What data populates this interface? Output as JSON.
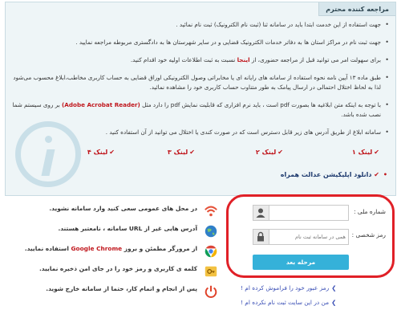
{
  "notice": {
    "title": "مراجعه کننده محترم",
    "bullets": [
      "جهت استفاده از این خدمت ابتدا باید در سامانه ثنا (ثبت نام الکترونیک) ثبت نام نمائید .",
      "جهت ثبت نام در مراکز استان ها به دفاتر خدمات الکترونیک قضایی و در سایر شهرستان ها به دادگستری مربوطه مراجعه نمایید .",
      "طبق ماده ۱۳ آیین نامه نحوه استفاده از سامانه های رایانه ای یا مخابراتی وصول الکترونیکی اوراق قضایی به حساب کاربری مخاطب،ابلاغ محسوب می‌شود لذا به لحاظ اختلال احتمالی در ارسال پیامک به طور متناوب حساب کاربری خود را مشاهده نمائید.",
      "سامانه ابلاغ از طریق آدرس های زیر قابل دسترس است که در صورت کندی یا اختلال می توانید از آن استفاده کنید ."
    ],
    "access_pre": "برای سهولت امر می توانید قبل از مراجعه حضوری، از",
    "access_link": "اینجا",
    "access_post": "نسبت به ثبت اطلاعات اولیه خود اقدام کنید.",
    "pdf_pre": "با توجه به اینکه متن ابلاغیه ها بصورت pdf است ، باید نرم افزاری که قابلیت نمایش pdf را دارد مثل",
    "pdf_link": "(Adobe Acrobat Reader)",
    "pdf_post": "بر روی سیستم شما نصب شده باشد.",
    "links": [
      "لینک ۱",
      "لینک ۲",
      "لینک ۳",
      "لینک ۴"
    ],
    "app_download": "دانلود اپلیکیشن عدالت همراه"
  },
  "tips": [
    {
      "icon": "wifi-icon",
      "text": "در محل های عمومی سعی کنید وارد سامانه نشوید."
    },
    {
      "icon": "globe-icon",
      "text": "آدرس هایی غیر از URL سامانه ، نامعتبر هستند."
    },
    {
      "icon": "chrome-icon",
      "pre": "از مرورگر مطمئن و بروز",
      "brand": "Google Chrome",
      "post": "استفاده نمایید."
    },
    {
      "icon": "key-icon",
      "text": "کلمه ی کاربری و رمز خود را در جای امن ذخیره نمایید."
    },
    {
      "icon": "power-icon",
      "text": "پس از انجام و اتمام کار، حتما از سامانه خارج شوید."
    }
  ],
  "login": {
    "national_code_label": "شماره ملی :",
    "national_code_value": "",
    "password_label": "رمز شخصی :",
    "password_placeholder": "همی در سامانه ثبت نام",
    "submit_label": "مرحله بعد"
  },
  "aux_links": {
    "forgot": "رمز عبور خود را فراموش کرده ام !",
    "not_registered": "من در این سایت ثبت نام نکرده ام !"
  },
  "colors": {
    "accent_red": "#c0161c",
    "button_blue": "#35b1d9",
    "link_blue": "#3a4fb5",
    "panel_bg": "#eef5f7",
    "highlight_border": "#e02027"
  }
}
